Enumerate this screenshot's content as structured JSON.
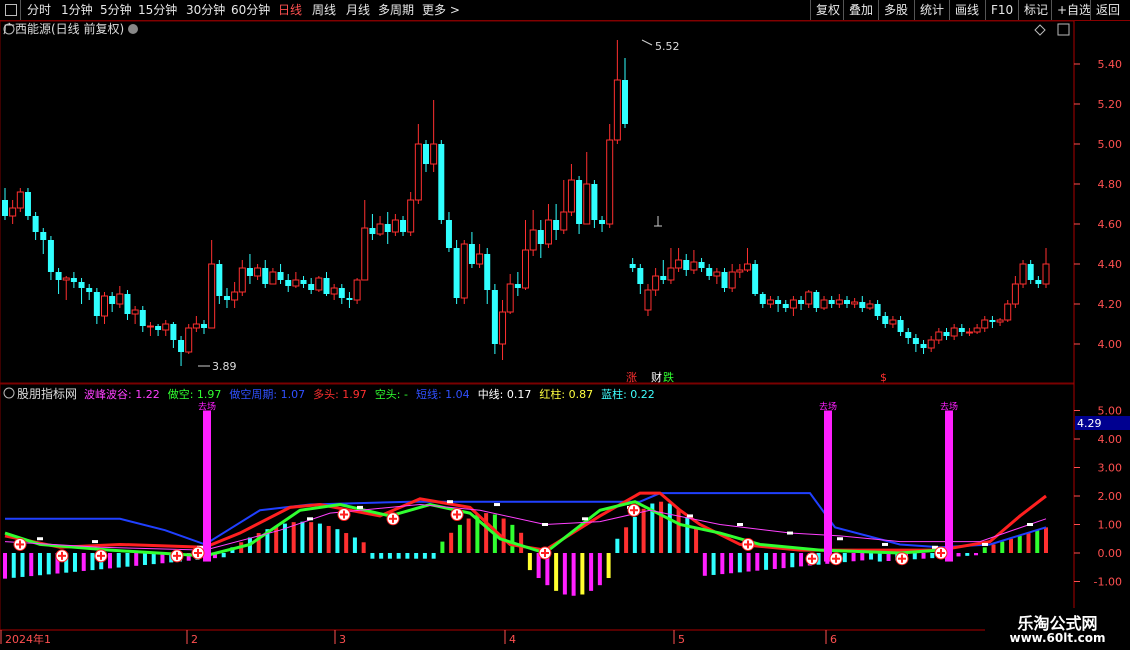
{
  "toolbar": {
    "left_items": [
      "分时",
      "1分钟",
      "5分钟",
      "15分钟",
      "30分钟",
      "60分钟",
      "日线",
      "周线",
      "月线",
      "多周期",
      "更多 >"
    ],
    "active": "日线",
    "right_items": [
      "复权",
      "叠加",
      "多股",
      "统计",
      "画线",
      "F10",
      "标记",
      "+自选",
      "返回"
    ]
  },
  "main_panel": {
    "title": "广西能源(日线 前复权)",
    "price_axis": [
      "5.40",
      "5.20",
      "5.00",
      "4.80",
      "4.60",
      "4.40",
      "4.20",
      "4.00"
    ],
    "high_label": "5.52",
    "low_label": "3.89",
    "markers": [
      {
        "text": "涨",
        "color": "#ff3030"
      },
      {
        "text": "财",
        "color": "#ffffff"
      },
      {
        "text": "跌",
        "color": "#30ff30"
      },
      {
        "text": "$",
        "color": "#ff3030"
      }
    ]
  },
  "indicator_panel": {
    "name": "股朋指标网",
    "legend": [
      {
        "label": "波峰波谷:",
        "value": "1.22",
        "color": "#ff40ff"
      },
      {
        "label": "做空:",
        "value": "1.97",
        "color": "#30ff30"
      },
      {
        "label": "做空周期:",
        "value": "1.07",
        "color": "#3050ff"
      },
      {
        "label": "多头:",
        "value": "1.97",
        "color": "#ff3030"
      },
      {
        "label": "空头:",
        "value": "-",
        "color": "#30ff30"
      },
      {
        "label": "短线:",
        "value": "1.04",
        "color": "#3050ff"
      },
      {
        "label": "中线:",
        "value": "0.17",
        "color": "#ffffff"
      },
      {
        "label": "红柱:",
        "value": "0.87",
        "color": "#ffff40"
      },
      {
        "label": "蓝柱:",
        "value": "0.22",
        "color": "#40ffff"
      }
    ],
    "axis": [
      "5.00",
      "4.00",
      "3.00",
      "2.00",
      "1.00",
      "0.00",
      "-1.00"
    ],
    "current_value": "4.29",
    "top_markers": [
      "去场",
      "去场",
      "去场"
    ]
  },
  "time_axis": [
    "2024年1",
    "2",
    "3",
    "4",
    "5",
    "6"
  ],
  "watermark": {
    "line1": "乐淘公式网",
    "line2": "www.60lt.com"
  },
  "colors": {
    "up": "#ff3030",
    "down": "#30ffff",
    "grid": "#7a0000",
    "axis_text": "#ff5050",
    "magenta": "#ff20ff"
  },
  "chart_data": {
    "type": "candlestick",
    "title": "广西能源(日线 前复权)",
    "ylim": [
      3.88,
      5.55
    ],
    "x": [
      "2024-01",
      "2024-02",
      "2024-03",
      "2024-04",
      "2024-05",
      "2024-06"
    ],
    "candles": [
      [
        4.72,
        4.64,
        4.78,
        4.62
      ],
      [
        4.64,
        4.68,
        4.72,
        4.6
      ],
      [
        4.68,
        4.76,
        4.78,
        4.66
      ],
      [
        4.76,
        4.64,
        4.78,
        4.62
      ],
      [
        4.64,
        4.56,
        4.66,
        4.52
      ],
      [
        4.56,
        4.52,
        4.58,
        4.45
      ],
      [
        4.52,
        4.36,
        4.54,
        4.32
      ],
      [
        4.36,
        4.32,
        4.38,
        4.25
      ],
      [
        4.32,
        4.33,
        4.34,
        4.22
      ],
      [
        4.33,
        4.31,
        4.36,
        4.28
      ],
      [
        4.31,
        4.28,
        4.33,
        4.2
      ],
      [
        4.28,
        4.26,
        4.3,
        4.22
      ],
      [
        4.26,
        4.14,
        4.28,
        4.1
      ],
      [
        4.14,
        4.24,
        4.26,
        4.1
      ],
      [
        4.24,
        4.2,
        4.26,
        4.16
      ],
      [
        4.2,
        4.25,
        4.29,
        4.18
      ],
      [
        4.25,
        4.15,
        4.27,
        4.12
      ],
      [
        4.15,
        4.17,
        4.19,
        4.1
      ],
      [
        4.17,
        4.09,
        4.19,
        4.06
      ],
      [
        4.09,
        4.09,
        4.11,
        4.04
      ],
      [
        4.09,
        4.07,
        4.1,
        4.04
      ],
      [
        4.07,
        4.1,
        4.12,
        4.04
      ],
      [
        4.1,
        4.02,
        4.11,
        3.98
      ],
      [
        4.02,
        3.96,
        4.04,
        3.89
      ],
      [
        3.96,
        4.08,
        4.1,
        3.95
      ],
      [
        4.08,
        4.1,
        4.14,
        4.06
      ],
      [
        4.1,
        4.08,
        4.12,
        4.05
      ],
      [
        4.08,
        4.4,
        4.52,
        4.08
      ],
      [
        4.4,
        4.24,
        4.42,
        4.2
      ],
      [
        4.24,
        4.22,
        4.28,
        4.18
      ],
      [
        4.22,
        4.26,
        4.31,
        4.18
      ],
      [
        4.26,
        4.38,
        4.42,
        4.24
      ],
      [
        4.38,
        4.34,
        4.45,
        4.3
      ],
      [
        4.34,
        4.38,
        4.4,
        4.32
      ],
      [
        4.38,
        4.3,
        4.42,
        4.28
      ],
      [
        4.3,
        4.36,
        4.38,
        4.3
      ],
      [
        4.36,
        4.32,
        4.4,
        4.3
      ],
      [
        4.32,
        4.29,
        4.35,
        4.26
      ],
      [
        4.29,
        4.32,
        4.36,
        4.28
      ],
      [
        4.32,
        4.3,
        4.34,
        4.28
      ],
      [
        4.3,
        4.27,
        4.33,
        4.25
      ],
      [
        4.27,
        4.33,
        4.34,
        4.26
      ],
      [
        4.33,
        4.25,
        4.36,
        4.24
      ],
      [
        4.25,
        4.28,
        4.3,
        4.22
      ],
      [
        4.28,
        4.23,
        4.3,
        4.2
      ],
      [
        4.23,
        4.22,
        4.26,
        4.18
      ],
      [
        4.22,
        4.32,
        4.33,
        4.2
      ],
      [
        4.32,
        4.58,
        4.72,
        4.32
      ],
      [
        4.58,
        4.55,
        4.65,
        4.52
      ],
      [
        4.55,
        4.6,
        4.64,
        4.54
      ],
      [
        4.6,
        4.56,
        4.66,
        4.5
      ],
      [
        4.56,
        4.62,
        4.65,
        4.54
      ],
      [
        4.62,
        4.56,
        4.64,
        4.54
      ],
      [
        4.56,
        4.72,
        4.76,
        4.54
      ],
      [
        4.72,
        5.0,
        5.1,
        4.7
      ],
      [
        5.0,
        4.9,
        5.02,
        4.86
      ],
      [
        4.9,
        5.0,
        5.22,
        4.86
      ],
      [
        5.0,
        4.62,
        5.02,
        4.6
      ],
      [
        4.62,
        4.48,
        4.66,
        4.46
      ],
      [
        4.48,
        4.23,
        4.52,
        4.2
      ],
      [
        4.23,
        4.5,
        4.52,
        4.2
      ],
      [
        4.5,
        4.4,
        4.56,
        4.38
      ],
      [
        4.4,
        4.45,
        4.5,
        4.38
      ],
      [
        4.45,
        4.27,
        4.48,
        4.2
      ],
      [
        4.27,
        4.0,
        4.3,
        3.95
      ],
      [
        4.0,
        4.16,
        4.22,
        3.92
      ],
      [
        4.16,
        4.3,
        4.35,
        4.15
      ],
      [
        4.3,
        4.28,
        4.36,
        4.24
      ],
      [
        4.28,
        4.47,
        4.62,
        4.27
      ],
      [
        4.47,
        4.57,
        4.67,
        4.44
      ],
      [
        4.57,
        4.5,
        4.62,
        4.43
      ],
      [
        4.5,
        4.62,
        4.7,
        4.48
      ],
      [
        4.62,
        4.57,
        4.7,
        4.52
      ],
      [
        4.57,
        4.66,
        4.82,
        4.55
      ],
      [
        4.66,
        4.82,
        4.9,
        4.64
      ],
      [
        4.82,
        4.6,
        4.84,
        4.55
      ],
      [
        4.6,
        4.8,
        4.96,
        4.6
      ],
      [
        4.8,
        4.62,
        4.82,
        4.58
      ],
      [
        4.62,
        4.6,
        4.64,
        4.56
      ],
      [
        4.6,
        5.02,
        5.1,
        4.58
      ],
      [
        5.02,
        5.32,
        5.52,
        5.0
      ],
      [
        5.32,
        5.1,
        5.43,
        5.08
      ],
      [
        4.4,
        4.38,
        4.43,
        4.36
      ],
      [
        4.38,
        4.3,
        4.4,
        4.25
      ],
      [
        4.17,
        4.27,
        4.3,
        4.14
      ],
      [
        4.27,
        4.34,
        4.38,
        4.24
      ],
      [
        4.34,
        4.32,
        4.42,
        4.3
      ],
      [
        4.32,
        4.38,
        4.48,
        4.3
      ],
      [
        4.38,
        4.42,
        4.48,
        4.36
      ],
      [
        4.42,
        4.37,
        4.45,
        4.34
      ],
      [
        4.37,
        4.41,
        4.47,
        4.35
      ],
      [
        4.41,
        4.38,
        4.43,
        4.36
      ],
      [
        4.38,
        4.34,
        4.4,
        4.32
      ],
      [
        4.34,
        4.36,
        4.38,
        4.3
      ],
      [
        4.36,
        4.28,
        4.38,
        4.26
      ],
      [
        4.28,
        4.36,
        4.4,
        4.26
      ],
      [
        4.36,
        4.37,
        4.4,
        4.33
      ],
      [
        4.37,
        4.4,
        4.48,
        4.36
      ],
      [
        4.4,
        4.25,
        4.42,
        4.24
      ],
      [
        4.25,
        4.2,
        4.26,
        4.18
      ],
      [
        4.2,
        4.22,
        4.24,
        4.18
      ],
      [
        4.22,
        4.2,
        4.24,
        4.16
      ],
      [
        4.2,
        4.18,
        4.22,
        4.16
      ],
      [
        4.18,
        4.22,
        4.24,
        4.14
      ],
      [
        4.22,
        4.2,
        4.24,
        4.17
      ],
      [
        4.2,
        4.26,
        4.27,
        4.18
      ],
      [
        4.26,
        4.18,
        4.27,
        4.16
      ],
      [
        4.18,
        4.22,
        4.24,
        4.17
      ],
      [
        4.22,
        4.2,
        4.24,
        4.18
      ],
      [
        4.2,
        4.22,
        4.25,
        4.18
      ],
      [
        4.22,
        4.2,
        4.24,
        4.18
      ],
      [
        4.2,
        4.21,
        4.23,
        4.18
      ],
      [
        4.21,
        4.18,
        4.24,
        4.16
      ],
      [
        4.18,
        4.2,
        4.22,
        4.17
      ],
      [
        4.2,
        4.14,
        4.22,
        4.12
      ],
      [
        4.14,
        4.1,
        4.16,
        4.08
      ],
      [
        4.1,
        4.12,
        4.14,
        4.08
      ],
      [
        4.12,
        4.06,
        4.14,
        4.04
      ],
      [
        4.06,
        4.03,
        4.08,
        4.0
      ],
      [
        4.03,
        4.0,
        4.05,
        3.96
      ],
      [
        4.0,
        3.98,
        4.02,
        3.95
      ],
      [
        3.98,
        4.02,
        4.04,
        3.96
      ],
      [
        4.02,
        4.06,
        4.08,
        4.0
      ],
      [
        4.06,
        4.04,
        4.08,
        4.02
      ],
      [
        4.04,
        4.08,
        4.1,
        4.02
      ],
      [
        4.08,
        4.06,
        4.1,
        4.04
      ],
      [
        4.06,
        4.06,
        4.08,
        4.04
      ],
      [
        4.06,
        4.08,
        4.1,
        4.05
      ],
      [
        4.08,
        4.12,
        4.14,
        4.06
      ],
      [
        4.12,
        4.11,
        4.14,
        4.08
      ],
      [
        4.11,
        4.12,
        4.13,
        4.09
      ],
      [
        4.12,
        4.2,
        4.22,
        4.11
      ],
      [
        4.2,
        4.3,
        4.34,
        4.18
      ],
      [
        4.3,
        4.4,
        4.42,
        4.28
      ],
      [
        4.4,
        4.32,
        4.42,
        4.3
      ],
      [
        4.32,
        4.3,
        4.34,
        4.28
      ],
      [
        4.3,
        4.4,
        4.48,
        4.28
      ]
    ]
  }
}
